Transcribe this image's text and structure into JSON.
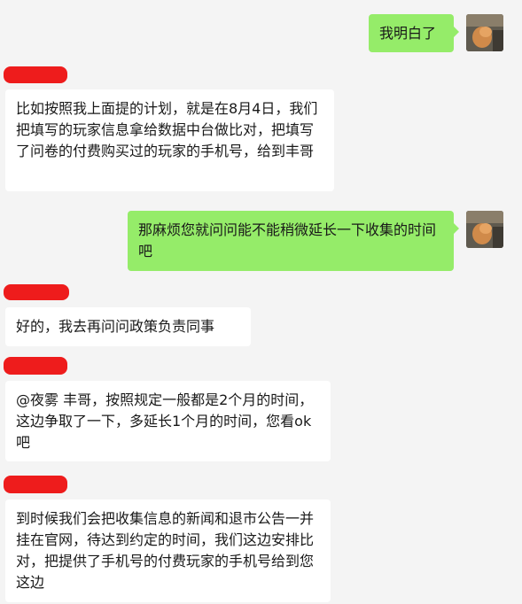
{
  "messages": [
    {
      "side": "right",
      "text": "我明白了"
    },
    {
      "side": "left",
      "text": "比如按照我上面提的计划，就是在8月4日，我们把填写的玩家信息拿给数据中台做比对，把填写了问卷的付费购买过的玩家的手机号，给到丰哥"
    },
    {
      "side": "right",
      "text": "那麻烦您就问问能不能稍微延长一下收集的时间吧"
    },
    {
      "side": "left",
      "text": "好的，我去再问问政策负责同事"
    },
    {
      "side": "left",
      "text": "@夜雾 丰哥，按照规定一般都是2个月的时间，这边争取了一下，多延长1个月的时间，您看ok吧"
    },
    {
      "side": "left",
      "text": "到时候我们会把收集信息的新闻和退市公告一并挂在官网，待达到约定的时间，我们这边安排比对，把提供了手机号的付费玩家的手机号给到您这边"
    }
  ],
  "colors": {
    "background": "#f4f4f4",
    "bubble_out": "#95ec69",
    "bubble_in": "#ffffff",
    "redaction": "#ee1c1c"
  }
}
